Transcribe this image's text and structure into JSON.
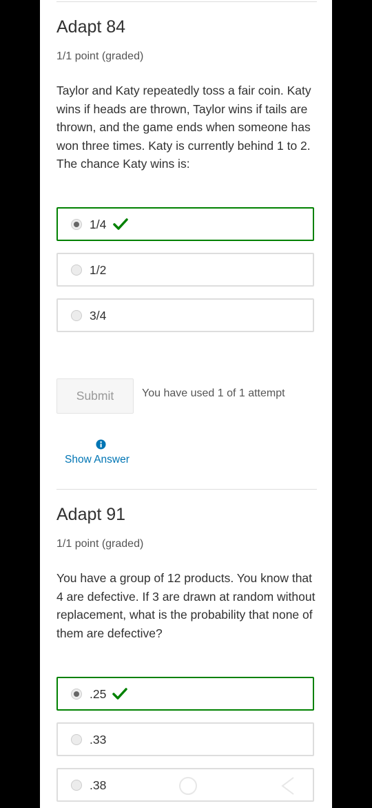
{
  "problems": [
    {
      "title": "Adapt 84",
      "points": "1/1 point (graded)",
      "question": "Taylor and Katy repeatedly toss a fair coin. Katy wins if heads are thrown, Taylor wins if tails are thrown, and the game ends when someone has won three times. Katy is currently behind 1 to 2. The chance Katy wins is:",
      "choices": [
        {
          "label": "1/4",
          "selected": true,
          "correct": true
        },
        {
          "label": "1/2",
          "selected": false,
          "correct": false
        },
        {
          "label": "3/4",
          "selected": false,
          "correct": false
        }
      ],
      "submit_label": "Submit",
      "attempts_text": "You have used 1 of 1 attempt",
      "show_answer_label": "Show Answer",
      "info_icon": "info-circle-icon"
    },
    {
      "title": "Adapt 91",
      "points": "1/1 point (graded)",
      "question": "You have a group of 12 products. You know that 4 are defective. If 3 are drawn at random without replacement, what is the probability that none of them are defective?",
      "choices": [
        {
          "label": ".25",
          "selected": true,
          "correct": true
        },
        {
          "label": ".33",
          "selected": false,
          "correct": false
        },
        {
          "label": ".38",
          "selected": false,
          "correct": false
        }
      ]
    }
  ],
  "colors": {
    "correct_border": "#008100",
    "checkmark": "#008100",
    "link": "#0075b4",
    "text": "#313131"
  },
  "icons": {
    "correct": "checkmark-icon",
    "info": "info-circle-icon"
  }
}
